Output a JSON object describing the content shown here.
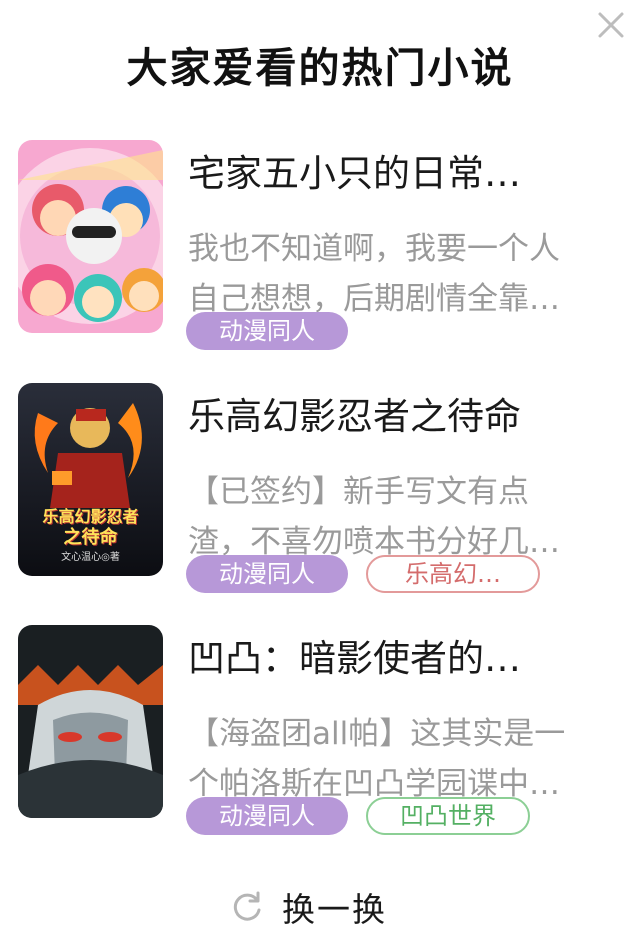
{
  "header": {
    "title": "大家爱看的热门小说",
    "close_icon": "close-icon"
  },
  "books": [
    {
      "title": "宅家五小只的日常…",
      "desc_line1": "我也不知道啊，我要一个人",
      "desc_line2": "自己想想，后期剧情全靠…",
      "tags": [
        "动漫同人"
      ]
    },
    {
      "title": "乐高幻影忍者之待命",
      "cover_title": "乐高幻影忍者",
      "cover_title2": "之待命",
      "cover_author": "文心温心◎著",
      "desc_line1": "【已签约】新手写文有点",
      "desc_line2": "渣，不喜勿喷本书分好几…",
      "tags": [
        "动漫同人",
        "乐高幻…"
      ]
    },
    {
      "title": "凹凸：暗影使者的…",
      "desc_line1": "【海盗团all帕】这其实是一",
      "desc_line2": "个帕洛斯在凹凸学园谍中…",
      "tags": [
        "动漫同人",
        "凹凸世界"
      ]
    }
  ],
  "footer": {
    "refresh_label": "换一换",
    "refresh_icon": "refresh-icon"
  },
  "colors": {
    "tag_purple": "#b798d8",
    "tag_red": "#e39a9a",
    "tag_green": "#8ccf95"
  }
}
